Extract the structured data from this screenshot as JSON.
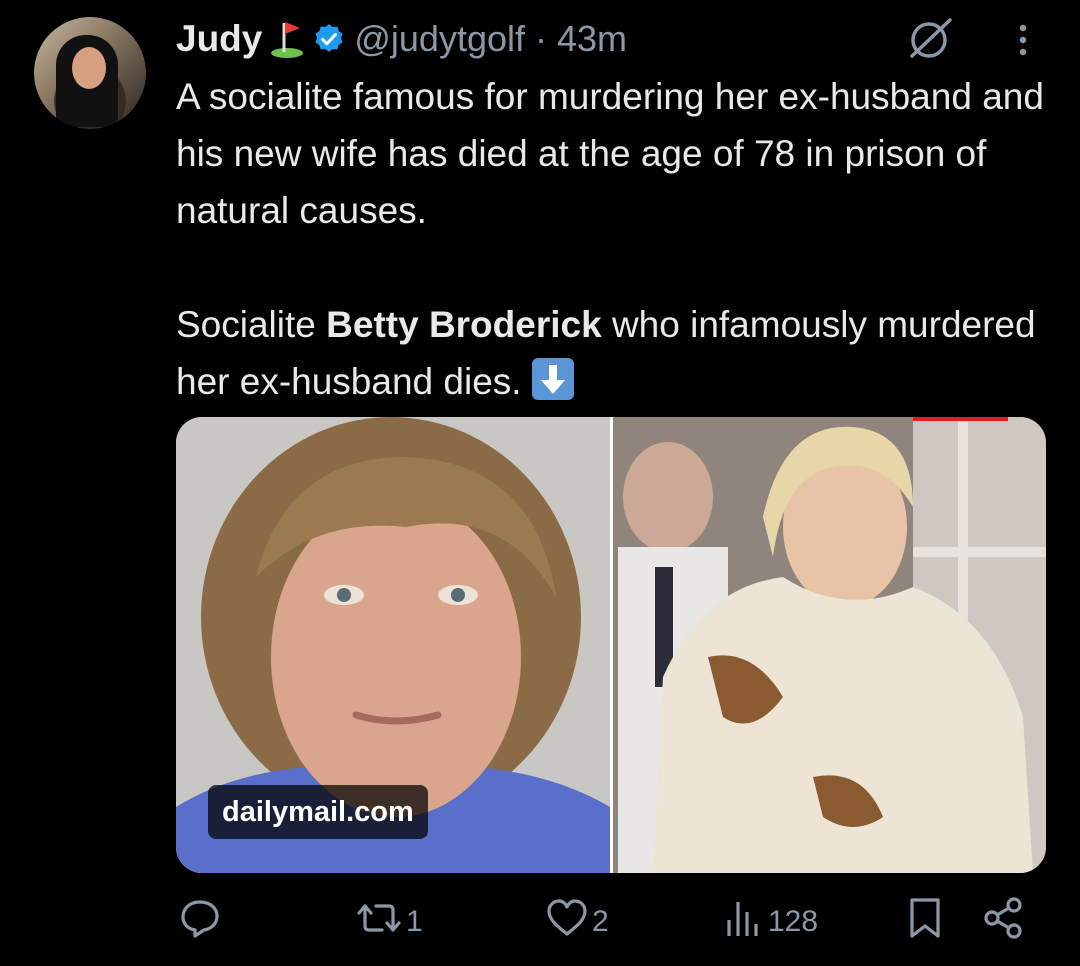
{
  "post": {
    "author_name": "Judy",
    "handle_time": "@judytgolf · 43m",
    "text_line1": "A socialite famous for murdering her ex-husband and his new wife has died at the age of 78 in prison of natural causes.",
    "text_p2_prefix": "Socialite ",
    "text_p2_bold": "Betty Broderick",
    "text_p2_suffix": " who infamously murdered her ex-husband dies. "
  },
  "media": {
    "source_label": "dailymail.com"
  },
  "actions": {
    "reply_count": "",
    "repost_count": "1",
    "like_count": "2",
    "view_count": "128"
  },
  "icons": [
    "golf-flag-icon",
    "verified-badge-icon",
    "grok-icon",
    "more-icon",
    "down-arrow-emoji-icon",
    "reply-icon",
    "repost-icon",
    "like-icon",
    "views-icon",
    "bookmark-icon",
    "share-icon"
  ],
  "colors": {
    "verified": "#1d9bf0",
    "muted": "#8b98a5",
    "text": "#e7e9ea",
    "background": "#000000"
  }
}
